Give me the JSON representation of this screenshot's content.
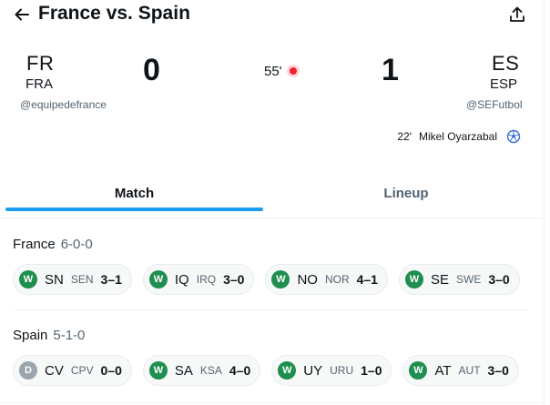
{
  "header": {
    "title": "France vs. Spain",
    "back_icon": "arrow-left-icon",
    "share_icon": "share-upload-icon"
  },
  "match": {
    "home": {
      "code": "FR",
      "abbr": "FRA",
      "handle": "@equipedefrance",
      "score": "0"
    },
    "away": {
      "code": "ES",
      "abbr": "ESP",
      "handle": "@SEFutbol",
      "score": "1"
    },
    "minute": "55'",
    "live_color": "#f4212e",
    "goals": [
      {
        "minute": "22'",
        "player": "Mikel Oyarzabal",
        "icon": "soccer-ball-icon"
      }
    ]
  },
  "tabs": [
    {
      "label": "Match",
      "active": true
    },
    {
      "label": "Lineup",
      "active": false
    }
  ],
  "colors": {
    "accent": "#1d9bf0",
    "win": "#1e8f4e",
    "draw": "#9aa5ad"
  },
  "form": [
    {
      "team": "France",
      "record": "6-0-0",
      "games": [
        {
          "result": "W",
          "iso": "SN",
          "code": "SEN",
          "score": "3–1"
        },
        {
          "result": "W",
          "iso": "IQ",
          "code": "IRQ",
          "score": "3–0"
        },
        {
          "result": "W",
          "iso": "NO",
          "code": "NOR",
          "score": "4–1"
        },
        {
          "result": "W",
          "iso": "SE",
          "code": "SWE",
          "score": "3–0"
        }
      ]
    },
    {
      "team": "Spain",
      "record": "5-1-0",
      "games": [
        {
          "result": "D",
          "iso": "CV",
          "code": "CPV",
          "score": "0–0"
        },
        {
          "result": "W",
          "iso": "SA",
          "code": "KSA",
          "score": "4–0"
        },
        {
          "result": "W",
          "iso": "UY",
          "code": "URU",
          "score": "1–0"
        },
        {
          "result": "W",
          "iso": "AT",
          "code": "AUT",
          "score": "3–0"
        }
      ]
    }
  ]
}
